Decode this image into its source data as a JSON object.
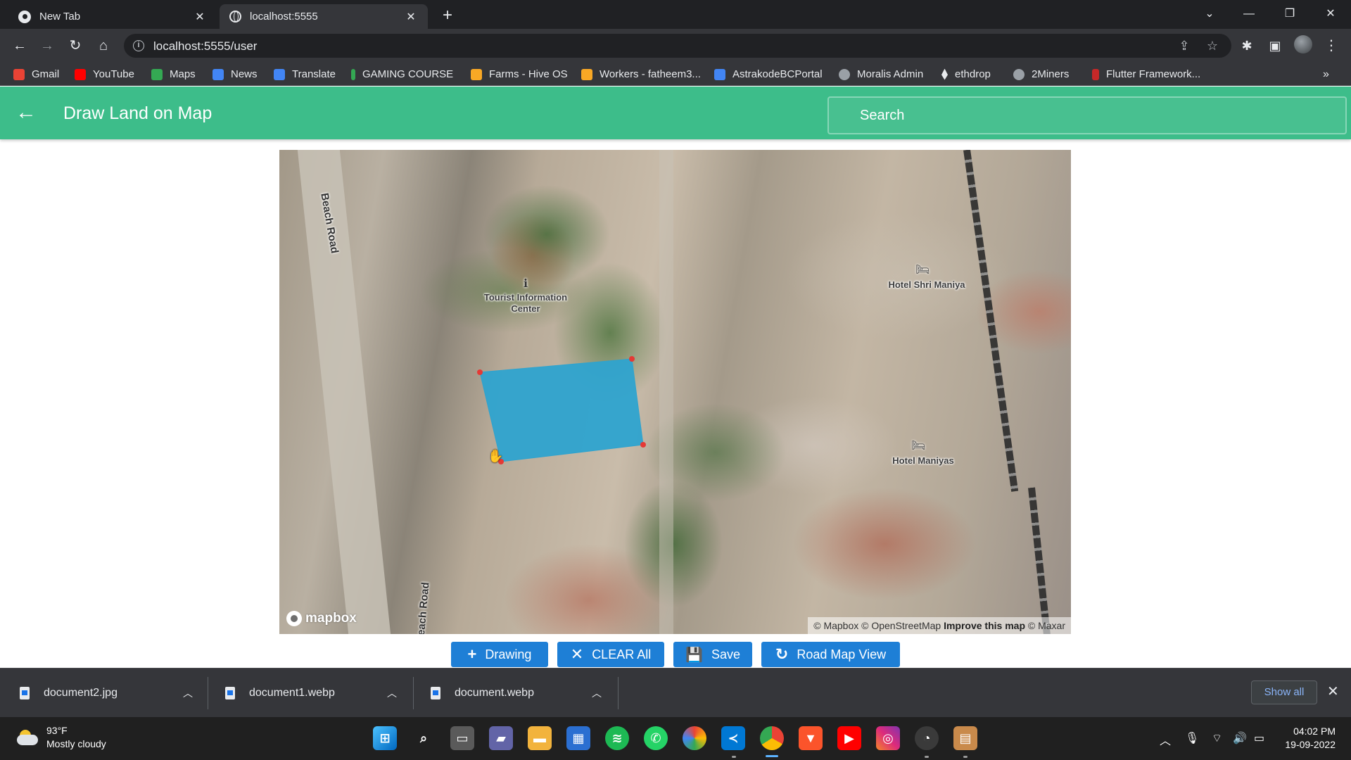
{
  "browser": {
    "tabs": [
      {
        "title": "New Tab",
        "active": false,
        "icon": "chrome-icon"
      },
      {
        "title": "localhost:5555",
        "active": true,
        "icon": "globe-icon"
      }
    ],
    "url": "localhost:5555/user",
    "bookmarks": [
      {
        "label": "Gmail",
        "color": "#ea4335"
      },
      {
        "label": "YouTube",
        "color": "#ff0000"
      },
      {
        "label": "Maps",
        "color": "#34a853"
      },
      {
        "label": "News",
        "color": "#4285f4"
      },
      {
        "label": "Translate",
        "color": "#4285f4"
      },
      {
        "label": "GAMING COURSE",
        "color": "#34a853"
      },
      {
        "label": "Farms - Hive OS",
        "color": "#f9a825"
      },
      {
        "label": "Workers - fatheem3...",
        "color": "#f9a825"
      },
      {
        "label": "AstrakodeBCPortal",
        "color": "#4285f4"
      },
      {
        "label": "Moralis Admin",
        "color": "#9aa0a6"
      },
      {
        "label": "ethdrop",
        "color": "#e8eaed"
      },
      {
        "label": "2Miners",
        "color": "#9aa0a6"
      },
      {
        "label": "Flutter Framework...",
        "color": "#c62828"
      }
    ]
  },
  "app": {
    "title": "Draw Land on Map",
    "search_placeholder": "Search",
    "accent": "#3dbd8a"
  },
  "map": {
    "labels": {
      "tourist": "Tourist Information Center",
      "hotel1": "Hotel Shri Maniya",
      "hotel2": "Hotel Maniyas",
      "road_top": "Beach Road",
      "road_bottom": "Beach Road"
    },
    "logo": "mapbox",
    "attribution": {
      "mapbox": "© Mapbox",
      "osm": "© OpenStreetMap",
      "improve": "Improve this map",
      "maxar": "© Maxar"
    },
    "polygon_color": "#2ea3cf",
    "vertex_color": "#e53935"
  },
  "actions": [
    {
      "label": "Drawing",
      "icon": "plus-icon"
    },
    {
      "label": "CLEAR All",
      "icon": "close-icon"
    },
    {
      "label": "Save",
      "icon": "save-icon"
    },
    {
      "label": "Road Map View",
      "icon": "refresh-icon"
    }
  ],
  "downloads": {
    "items": [
      "document2.jpg",
      "document1.webp",
      "document.webp"
    ],
    "show_all": "Show all"
  },
  "taskbar": {
    "weather_temp": "93°F",
    "weather_desc": "Mostly cloudy",
    "time": "04:02 PM",
    "date": "19-09-2022"
  }
}
